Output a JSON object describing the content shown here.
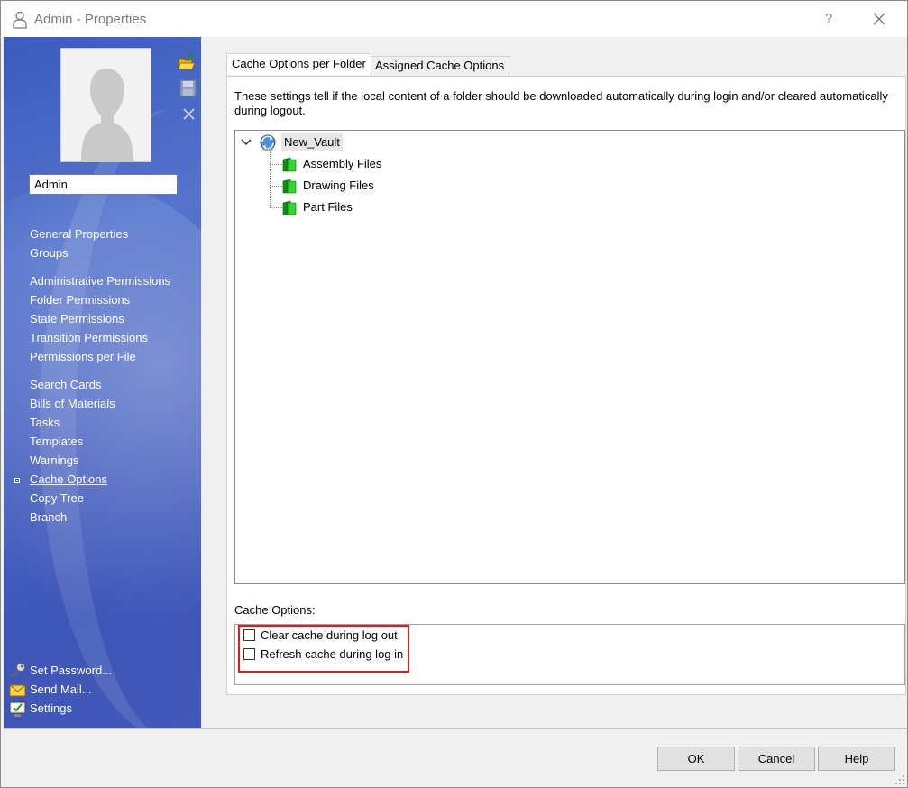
{
  "window": {
    "title": "Admin - Properties",
    "help_label": "?"
  },
  "sidebar": {
    "user_name": "Admin",
    "groups": [
      [
        "General Properties",
        "Groups"
      ],
      [
        "Administrative Permissions",
        "Folder Permissions",
        "State Permissions",
        "Transition Permissions",
        "Permissions per File"
      ],
      [
        "Search Cards",
        "Bills of Materials",
        "Tasks",
        "Templates",
        "Warnings",
        "Cache Options",
        "Copy Tree",
        "Branch"
      ]
    ],
    "nav": {
      "general_properties": "General Properties",
      "groups": "Groups",
      "administrative_permissions": "Administrative Permissions",
      "folder_permissions": "Folder Permissions",
      "state_permissions": "State Permissions",
      "transition_permissions": "Transition Permissions",
      "permissions_per_file": "Permissions per File",
      "search_cards": "Search Cards",
      "bills_of_materials": "Bills of Materials",
      "tasks": "Tasks",
      "templates": "Templates",
      "warnings": "Warnings",
      "cache_options": "Cache Options",
      "copy_tree": "Copy Tree",
      "branch": "Branch"
    },
    "active_item": "Cache Options",
    "bottom_links": {
      "set_password": "Set Password...",
      "send_mail": "Send Mail...",
      "settings": "Settings"
    },
    "icons": {
      "open_folder": "open-folder-icon",
      "save": "save-icon",
      "remove": "close-icon"
    }
  },
  "tabs": {
    "active": "Cache Options per Folder",
    "inactive": "Assigned Cache Options"
  },
  "panel": {
    "description": "These settings tell if the local content of a folder should be downloaded automatically during login and/or cleared automatically during logout.",
    "tree": {
      "root": "New_Vault",
      "children": {
        "c0": "Assembly Files",
        "c1": "Drawing Files",
        "c2": "Part Files"
      }
    },
    "cache_options_label": "Cache Options:",
    "checkboxes": {
      "clear_on_logout": {
        "label": "Clear cache during log out",
        "checked": false
      },
      "refresh_on_login": {
        "label": "Refresh cache during log in",
        "checked": false
      }
    },
    "highlight_color": "#e0191e"
  },
  "footer": {
    "ok": "OK",
    "cancel": "Cancel",
    "help": "Help"
  },
  "colors": {
    "sidebar_blue": "#4a63c2",
    "folder_green": "#21b521"
  }
}
